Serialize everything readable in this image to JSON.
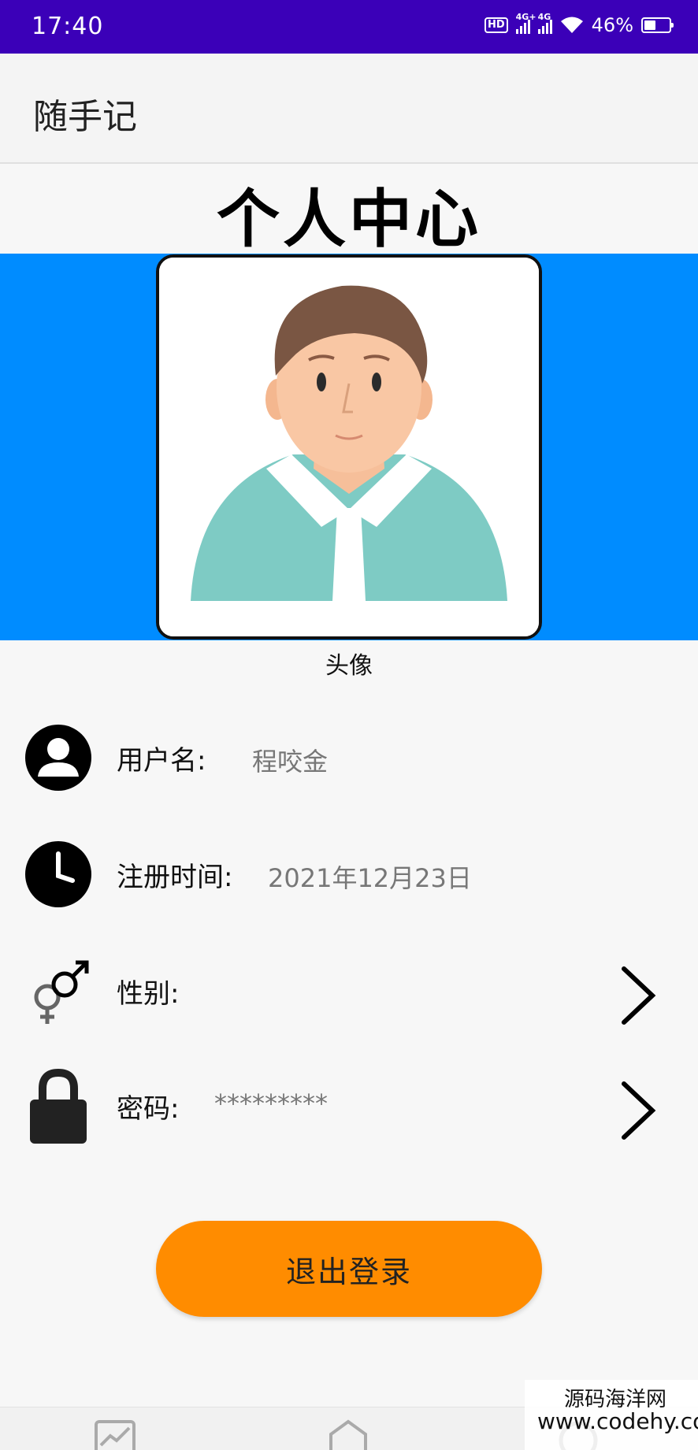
{
  "status_bar": {
    "time": "17:40",
    "hd_label": "HD",
    "network_1": "4G+",
    "network_2": "4G",
    "battery": "46%"
  },
  "app_bar": {
    "title": "随手记"
  },
  "profile": {
    "page_title": "个人中心",
    "avatar_caption": "头像",
    "band_color": "#008cff"
  },
  "rows": {
    "username": {
      "label": "用户名:",
      "value": "程咬金"
    },
    "register_time": {
      "label": "注册时间:",
      "value": "2021年12月23日"
    },
    "gender": {
      "label": "性别:",
      "value": ""
    },
    "password": {
      "label": "密码:",
      "value": "*********"
    }
  },
  "logout": {
    "label": "退出登录",
    "color": "#ff8c00"
  },
  "bottom_nav": {
    "items": [
      "chart-icon",
      "home-icon",
      "user-icon"
    ]
  },
  "watermark": {
    "line1": "源码海洋网",
    "line2": "www.codehy.com"
  }
}
